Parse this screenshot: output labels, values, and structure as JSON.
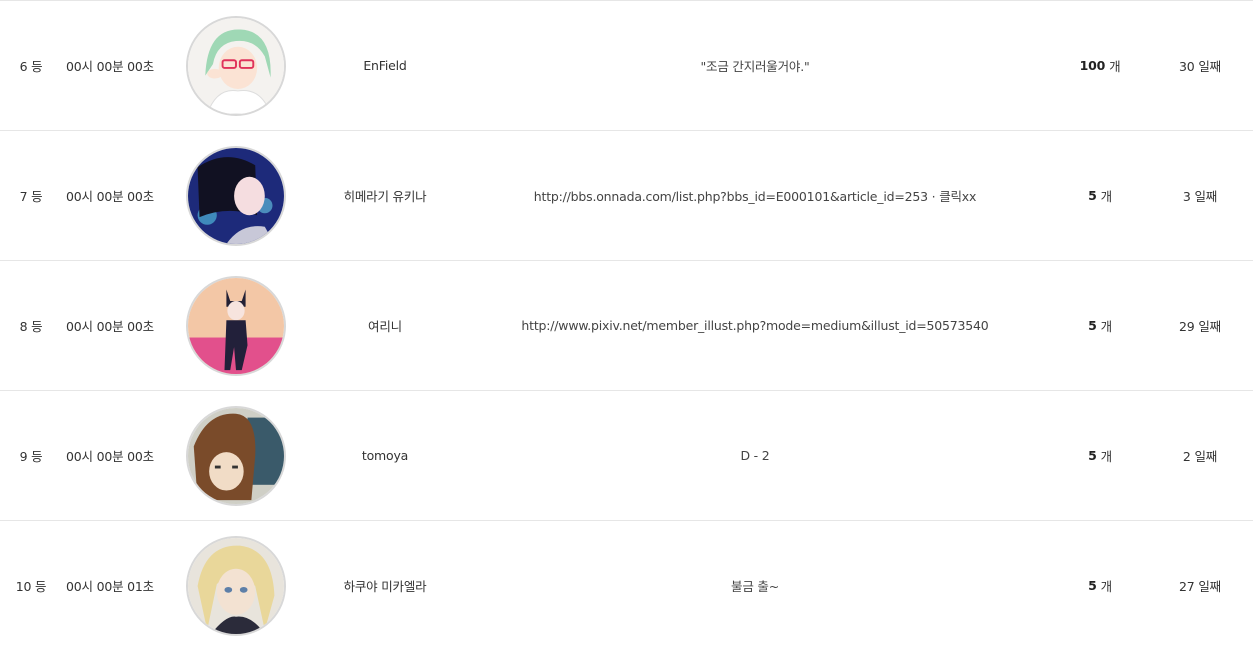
{
  "rows": [
    {
      "rank": "6 등",
      "time": "00시 00분 00초",
      "avatar_icon": "anime-girl-green-hair-glasses-avatar-icon",
      "name": "EnField",
      "message": "\"조금 간지러울거야.\"",
      "count_num": "100",
      "count_unit": "개",
      "days": "30 일째"
    },
    {
      "rank": "7 등",
      "time": "00시 00분 00초",
      "avatar_icon": "anime-girl-dark-hair-night-avatar-icon",
      "name": "히메라기 유키나",
      "message": "http://bbs.onnada.com/list.php?bbs_id=E000101&article_id=253 ·   클릭xx",
      "count_num": "5",
      "count_unit": "개",
      "days": "3 일째"
    },
    {
      "rank": "8 등",
      "time": "00시 00분 00초",
      "avatar_icon": "anime-catgirl-pink-background-avatar-icon",
      "name": "여리니",
      "message": "http://www.pixiv.net/member_illust.php?mode=medium&illust_id=50573540",
      "count_num": "5",
      "count_unit": "개",
      "days": "29 일째"
    },
    {
      "rank": "9 등",
      "time": "00시 00분 00초",
      "avatar_icon": "anime-girl-brown-hair-avatar-icon",
      "name": "tomoya",
      "message": "D - 2",
      "count_num": "5",
      "count_unit": "개",
      "days": "2 일째"
    },
    {
      "rank": "10 등",
      "time": "00시 00분 01초",
      "avatar_icon": "anime-boy-blonde-hair-avatar-icon",
      "name": "하쿠야 미카엘라",
      "message": "불금 출~",
      "count_num": "5",
      "count_unit": "개",
      "days": "27 일째"
    }
  ]
}
